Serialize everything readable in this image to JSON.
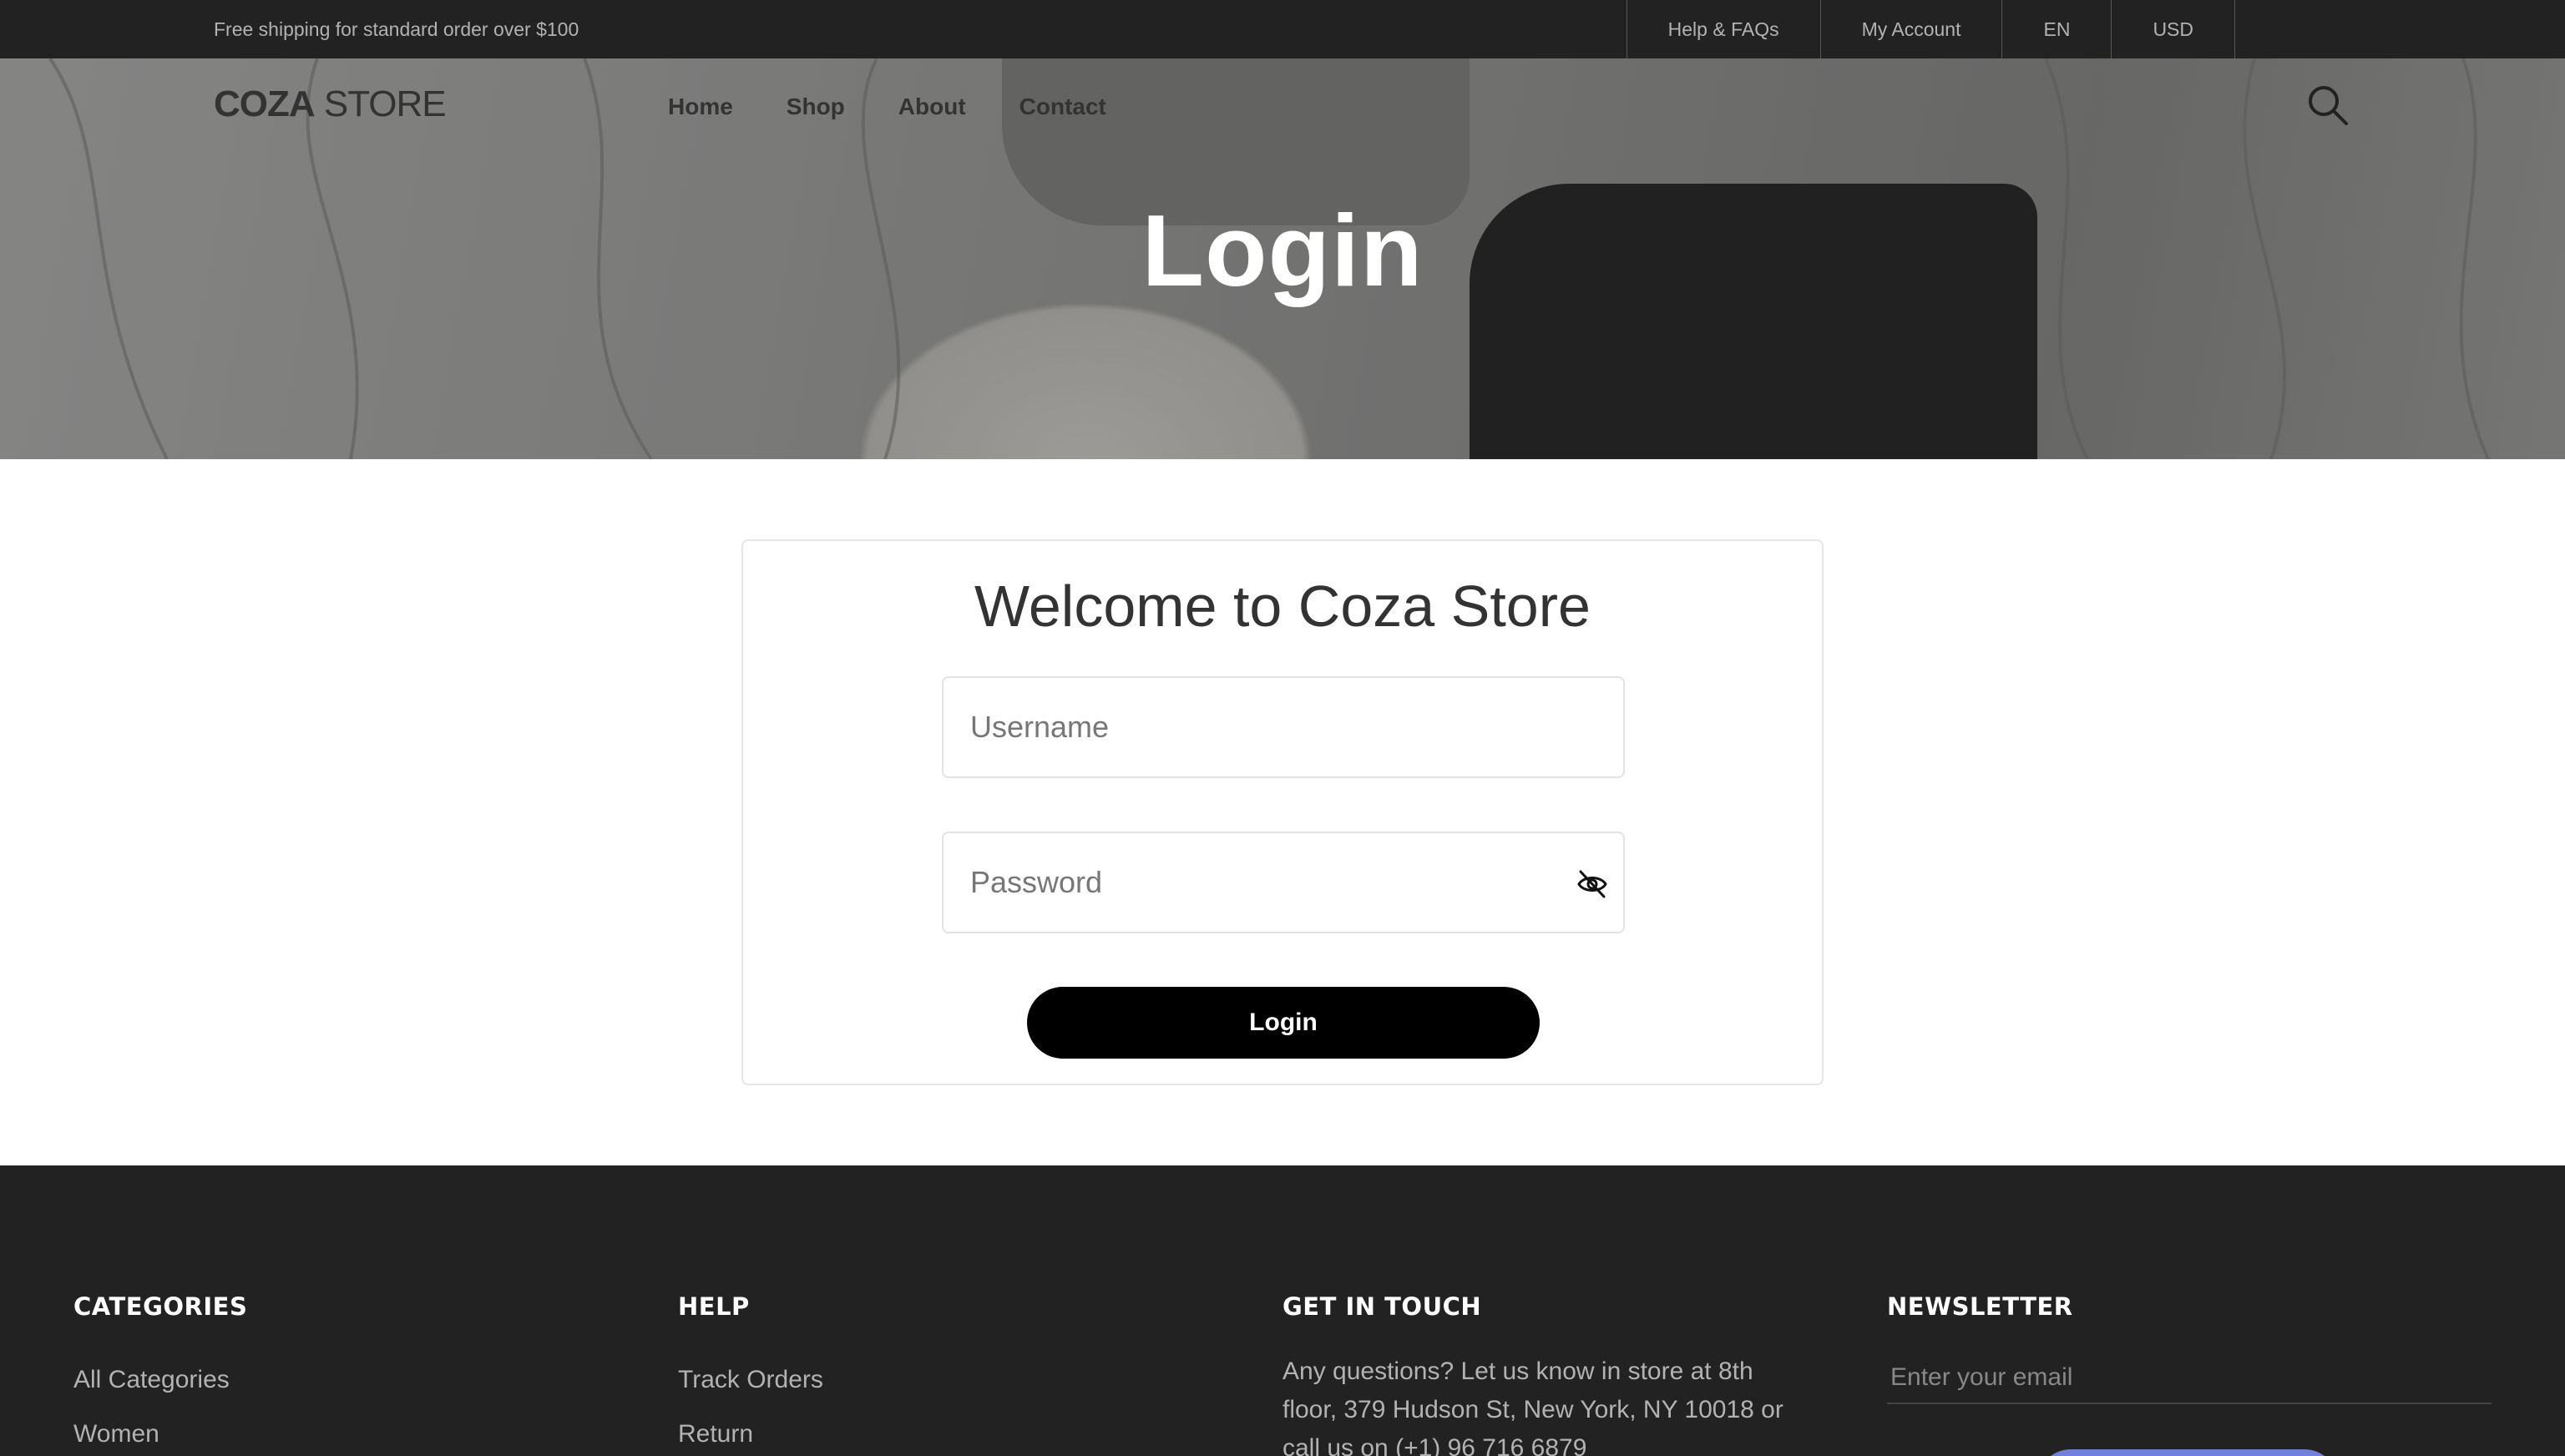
{
  "topbar": {
    "shipping_text": "Free shipping for standard order over $100",
    "links": [
      "Help & FAQs",
      "My Account",
      "EN",
      "USD"
    ]
  },
  "header": {
    "logo_bold": "COZA",
    "logo_light": " STORE",
    "nav": [
      "Home",
      "Shop",
      "About",
      "Contact"
    ],
    "search_icon": "search-icon"
  },
  "hero": {
    "title": "Login"
  },
  "login": {
    "welcome": "Welcome to Coza Store",
    "username_placeholder": "Username",
    "password_placeholder": "Password",
    "toggle_icon": "eye-slash-icon",
    "button_label": "Login"
  },
  "footer": {
    "categories": {
      "title": "CATEGORIES",
      "items": [
        "All Categories",
        "Women"
      ]
    },
    "help": {
      "title": "HELP",
      "items": [
        "Track Orders",
        "Return"
      ]
    },
    "contact": {
      "title": "GET IN TOUCH",
      "text": "Any questions? Let us know in store at 8th floor, 379 Hudson St, New York, NY 10018 or call us on (+1) 96 716 6879"
    },
    "newsletter": {
      "title": "NEWSLETTER",
      "placeholder": "Enter your email"
    }
  },
  "colors": {
    "dark": "#222222",
    "accent": "#717fe0",
    "button": "#000000",
    "muted": "#b2b2b2"
  }
}
